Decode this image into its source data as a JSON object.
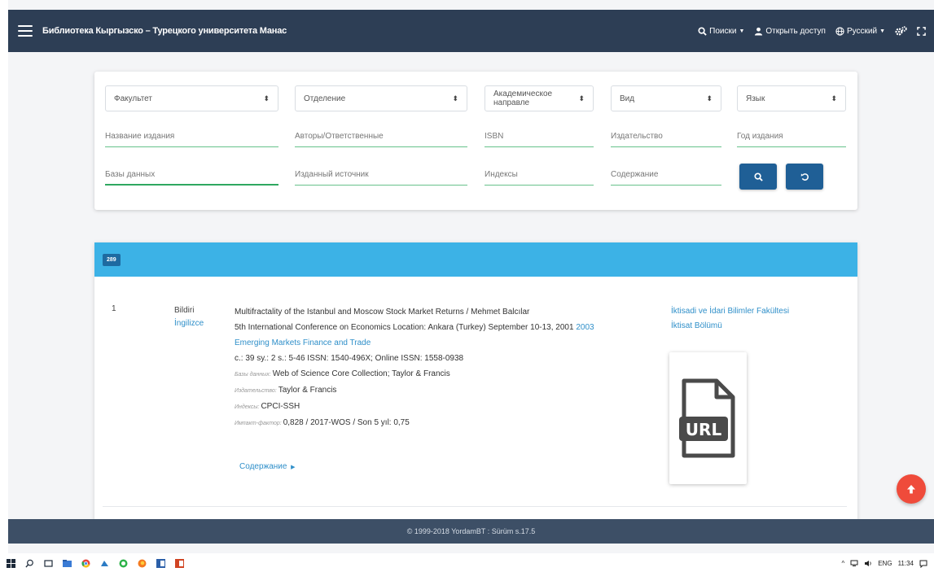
{
  "navbar": {
    "title": "Библиотека Кыргызско – Турецкого университета Манас",
    "search_menu": "Поиски",
    "access": "Открыть доступ",
    "language": "Русский"
  },
  "search": {
    "selects": [
      "Факультет",
      "Отделение",
      "Академическое направле",
      "Вид",
      "Язык"
    ],
    "fields_row1": [
      "Название издания",
      "Авторы/Ответственные",
      "ISBN",
      "Издательство",
      "Год издания"
    ],
    "fields_row2": [
      "Базы данных",
      "Изданный источник",
      "Индексы",
      "Содержание"
    ]
  },
  "results": {
    "count": "289",
    "item": {
      "number": "1",
      "type": "Bildiri",
      "language": "İngilizce",
      "title": "Multifractality of the Istanbul and Moscow Stock Market Returns / Mehmet Balcılar",
      "conference": "5th International Conference on Economics Location: Ankara (Turkey) September 10-13, 2001",
      "year": "2003",
      "journal": "Emerging Markets Finance and Trade",
      "pages": "с.: 39 sy.: 2 s.: 5-46 ISSN: 1540-496X; Online ISSN: 1558-0938",
      "databases_label": "Базы данных:",
      "databases": "Web of Science Core Collection; Taylor & Francis",
      "publisher_label": "Издательство:",
      "publisher": "Taylor & Francis",
      "index_label": "Индексы:",
      "index": "CPCI-SSH",
      "impact_label": "Импакт-фактор:",
      "impact": "0,828 / 2017-WOS / Son 5 yıl: 0,75",
      "contents": "Содержание",
      "faculty": "İktisadi ve İdari Bilimler Fakültesi",
      "department": "İktisat Bölümü",
      "file_label": "URL"
    }
  },
  "footer": {
    "text": "© 1999-2018 YordamBT : Sürüm s.17.5"
  },
  "taskbar": {
    "lang": "ENG",
    "time": "11:34"
  },
  "colors": {
    "navbar": "#2d3e55",
    "results_header": "#3cb2e6",
    "button": "#1f5f96",
    "link": "#2f8fc9",
    "scroll_top": "#ef4b3b",
    "footer": "#3d4f66"
  }
}
